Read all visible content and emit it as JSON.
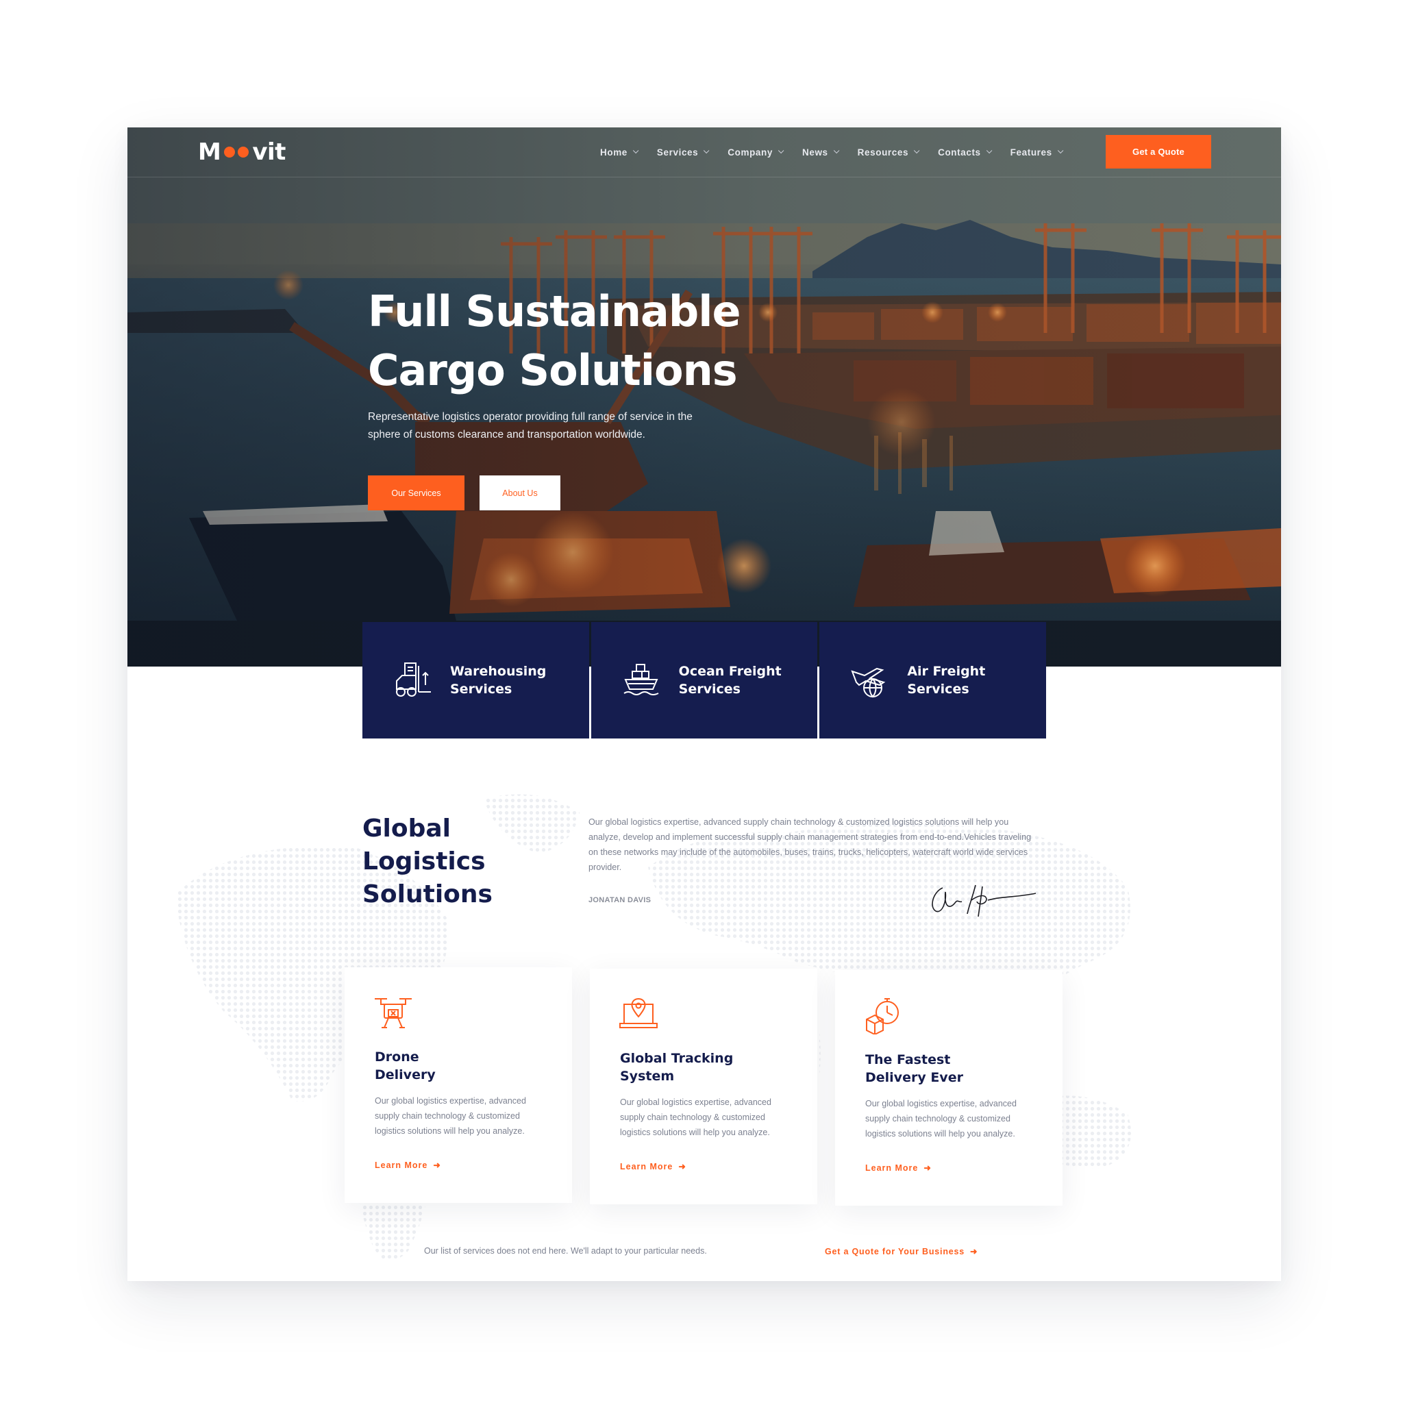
{
  "brand": {
    "logo_left": "M",
    "logo_right": "vit",
    "accent_color": "#fe5f1f",
    "navy_color": "#151d4f"
  },
  "nav": {
    "items": [
      {
        "label": "Home"
      },
      {
        "label": "Services"
      },
      {
        "label": "Company"
      },
      {
        "label": "News"
      },
      {
        "label": "Resources"
      },
      {
        "label": "Contacts"
      },
      {
        "label": "Features"
      }
    ],
    "cta_label": "Get a Quote"
  },
  "hero": {
    "title_line1": "Full Sustainable",
    "title_line2": "Cargo Solutions",
    "subtitle": "Representative logistics operator providing full range of service in the sphere of customs clearance and transportation worldwide.",
    "primary_button": "Our Services",
    "secondary_button": "About Us"
  },
  "service_bar": [
    {
      "line1": "Warehousing",
      "line2": "Services",
      "icon": "forklift-icon"
    },
    {
      "line1": "Ocean Freight",
      "line2": "Services",
      "icon": "cargo-ship-icon"
    },
    {
      "line1": "Air Freight",
      "line2": "Services",
      "icon": "airplane-globe-icon"
    }
  ],
  "intro": {
    "title_line1": "Global Logistics",
    "title_line2": "Solutions",
    "text": "Our global logistics expertise, advanced supply chain technology & customized logistics solutions will help you analyze, develop and implement successful supply chain management strategies from end-to-end.Vehicles traveling on these networks may include of the automobiles, buses, trains, trucks, helicopters, watercraft world wide services provider.",
    "author": "JONATAN DAVIS"
  },
  "cards": [
    {
      "title_line1": "Drone",
      "title_line2": "Delivery",
      "icon": "drone-icon",
      "desc": "Our global logistics expertise, advanced supply chain technology & customized logistics solutions will help you analyze.",
      "link": "Learn More"
    },
    {
      "title_line1": "Global Tracking",
      "title_line2": "System",
      "icon": "laptop-location-icon",
      "desc": "Our global logistics expertise, advanced supply chain technology & customized logistics solutions will help you analyze.",
      "link": "Learn More"
    },
    {
      "title_line1": "The Fastest",
      "title_line2": "Delivery Ever",
      "icon": "stopwatch-box-icon",
      "desc": "Our global logistics expertise, advanced supply chain technology & customized logistics solutions will help you analyze.",
      "link": "Learn More"
    }
  ],
  "footer": {
    "note": "Our list of services does not end here. We'll adapt to your particular needs.",
    "link": "Get a Quote for Your Business"
  }
}
